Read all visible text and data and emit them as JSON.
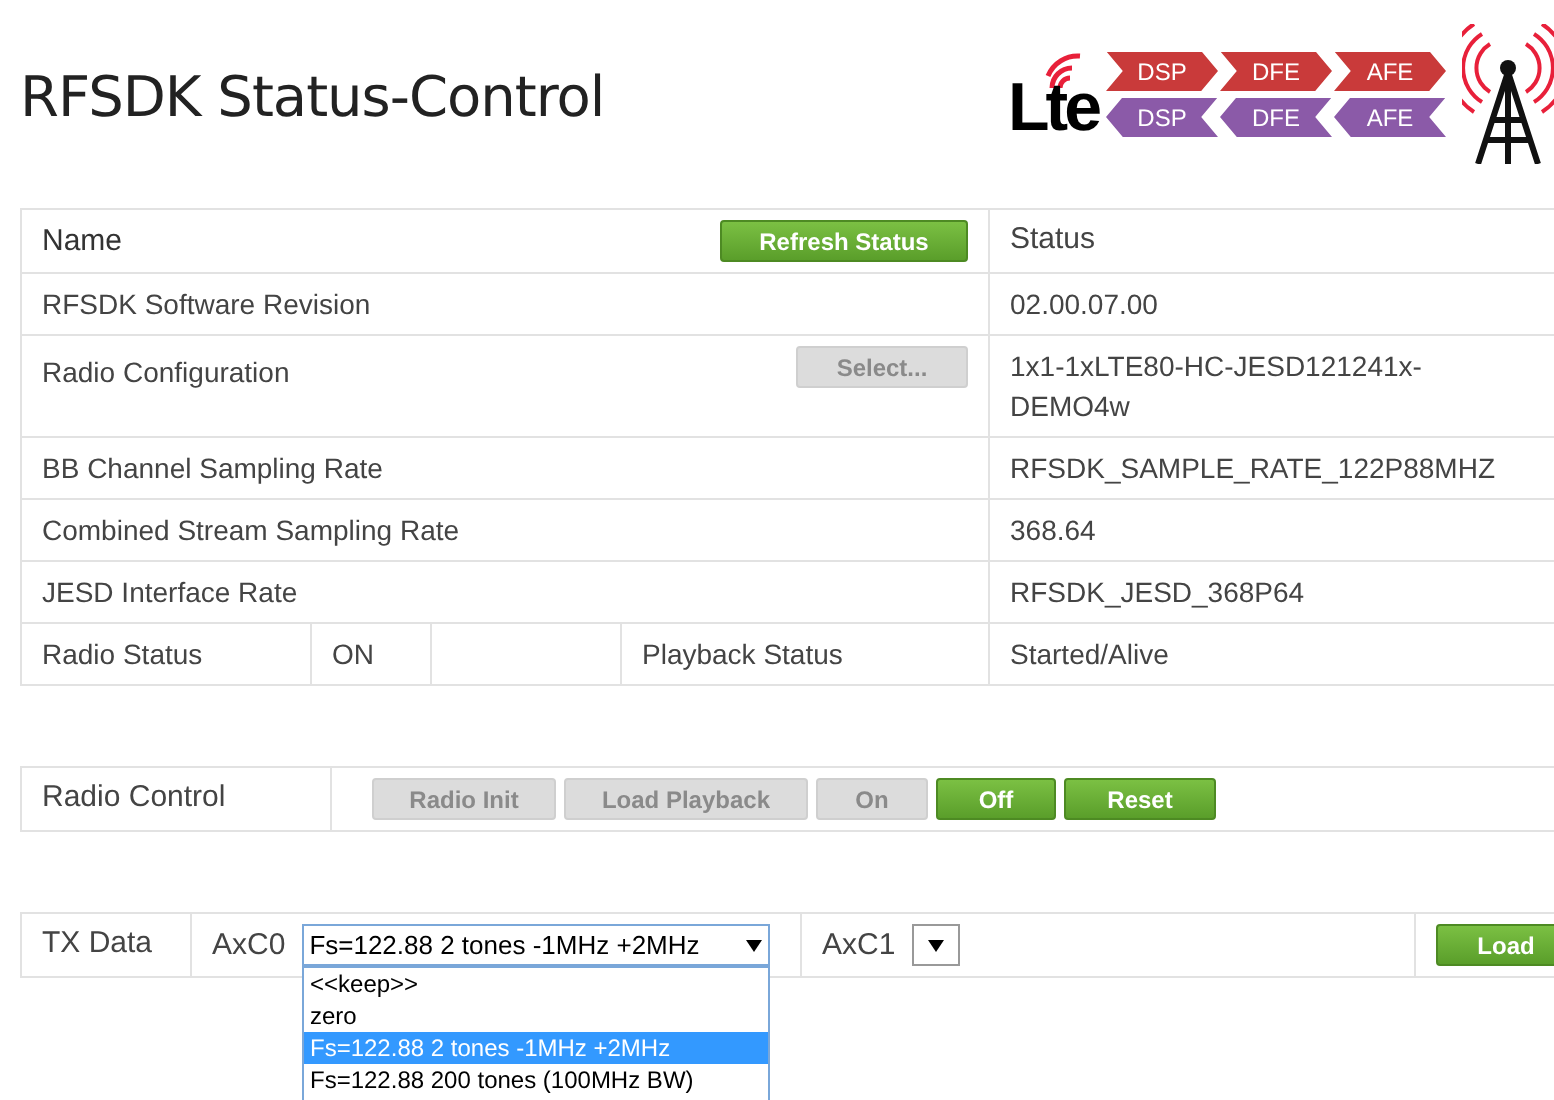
{
  "title": "RFSDK Status-Control",
  "logo": {
    "lte": "Lte",
    "tx_chain": [
      "DSP",
      "DFE",
      "AFE"
    ],
    "rx_chain": [
      "DSP",
      "DFE",
      "AFE"
    ]
  },
  "status_table": {
    "header": {
      "name": "Name",
      "status": "Status",
      "button": {
        "label": "Refresh Status",
        "disabled": false
      }
    },
    "rows": [
      {
        "kind": "plain",
        "name": "RFSDK Software Revision",
        "value": "02.00.07.00"
      },
      {
        "kind": "button",
        "name": "Radio Configuration",
        "value": "1x1-1xLTE80-HC-JESD121241x-DEMO4w",
        "button": {
          "label": "Select...",
          "disabled": true
        }
      },
      {
        "kind": "plain",
        "name": "BB Channel Sampling Rate",
        "value": "RFSDK_SAMPLE_RATE_122P88MHZ"
      },
      {
        "kind": "plain",
        "name": "Combined Stream Sampling Rate",
        "value": "368.64"
      },
      {
        "kind": "plain",
        "name": "JESD Interface Rate",
        "value": "RFSDK_JESD_368P64"
      },
      {
        "kind": "split",
        "name": "Radio Status",
        "radio_value": "ON",
        "playback_label": "Playback Status",
        "value": "Started/Alive"
      }
    ]
  },
  "radio_control": {
    "label": "Radio Control",
    "buttons": [
      {
        "label": "Radio Init",
        "disabled": true
      },
      {
        "label": "Load Playback",
        "disabled": true
      },
      {
        "label": "On",
        "disabled": true
      },
      {
        "label": "Off",
        "disabled": false
      },
      {
        "label": "Reset",
        "disabled": false
      }
    ]
  },
  "tx_data": {
    "label": "TX Data",
    "axc0": {
      "label": "AxC0",
      "value": "Fs=122.88 2 tones -1MHz +2MHz",
      "expanded": true,
      "options": [
        {
          "label": "<<keep>>",
          "selected": false
        },
        {
          "label": "zero",
          "selected": false
        },
        {
          "label": "Fs=122.88 2 tones -1MHz +2MHz",
          "selected": true
        },
        {
          "label": "Fs=122.88 200 tones (100MHz BW)",
          "selected": false
        }
      ]
    },
    "axc1": {
      "label": "AxC1"
    },
    "load_button": {
      "label": "Load",
      "disabled": false
    }
  }
}
